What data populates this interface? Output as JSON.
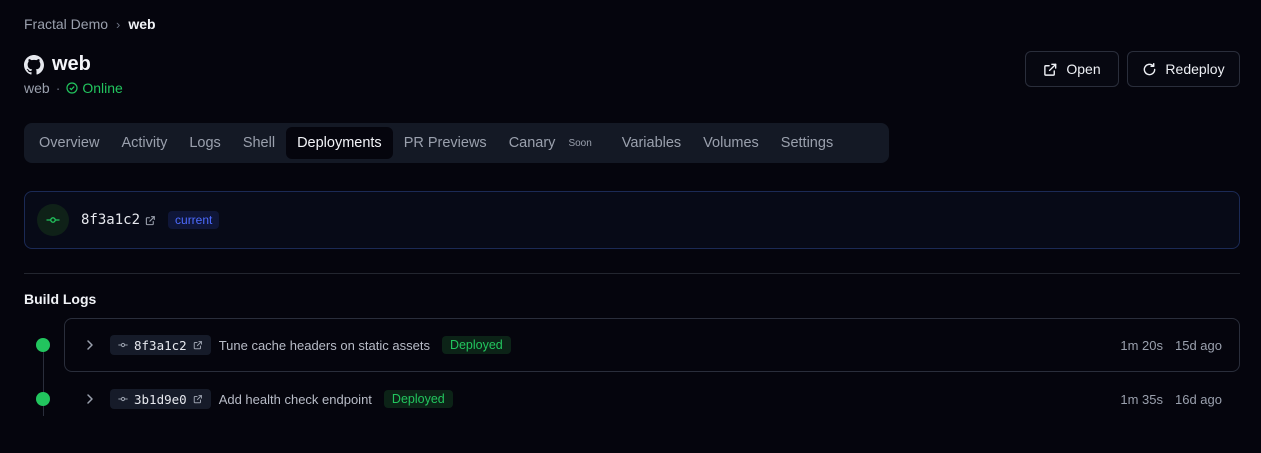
{
  "breadcrumb": {
    "project": "Fractal Demo",
    "service": "web"
  },
  "header": {
    "title": "web",
    "subtitle": "web",
    "status": "Online"
  },
  "actions": {
    "open_label": "Open",
    "redeploy_label": "Redeploy"
  },
  "tabs": [
    {
      "label": "Overview"
    },
    {
      "label": "Activity"
    },
    {
      "label": "Logs"
    },
    {
      "label": "Shell"
    },
    {
      "label": "Deployments",
      "active": true
    },
    {
      "label": "PR Previews"
    },
    {
      "label": "Canary",
      "badge": "Soon"
    },
    {
      "label": "Variables"
    },
    {
      "label": "Volumes"
    },
    {
      "label": "Settings"
    }
  ],
  "current_deployment": {
    "sha": "8f3a1c2",
    "badge": "current"
  },
  "build_logs": {
    "title": "Build Logs",
    "rows": [
      {
        "sha": "8f3a1c2",
        "message": "Tune cache headers on static assets",
        "status": "Deployed",
        "duration": "1m 20s",
        "age": "15d ago"
      },
      {
        "sha": "3b1d9e0",
        "message": "Add health check endpoint",
        "status": "Deployed",
        "duration": "1m 35s",
        "age": "16d ago"
      }
    ]
  },
  "colors": {
    "accent_green": "#22c55e",
    "accent_blue": "#4d6bff",
    "background": "#05050d"
  },
  "icons": [
    "github-icon",
    "check-circle-icon",
    "external-link-icon",
    "refresh-icon",
    "git-commit-icon",
    "chevron-right-icon"
  ]
}
